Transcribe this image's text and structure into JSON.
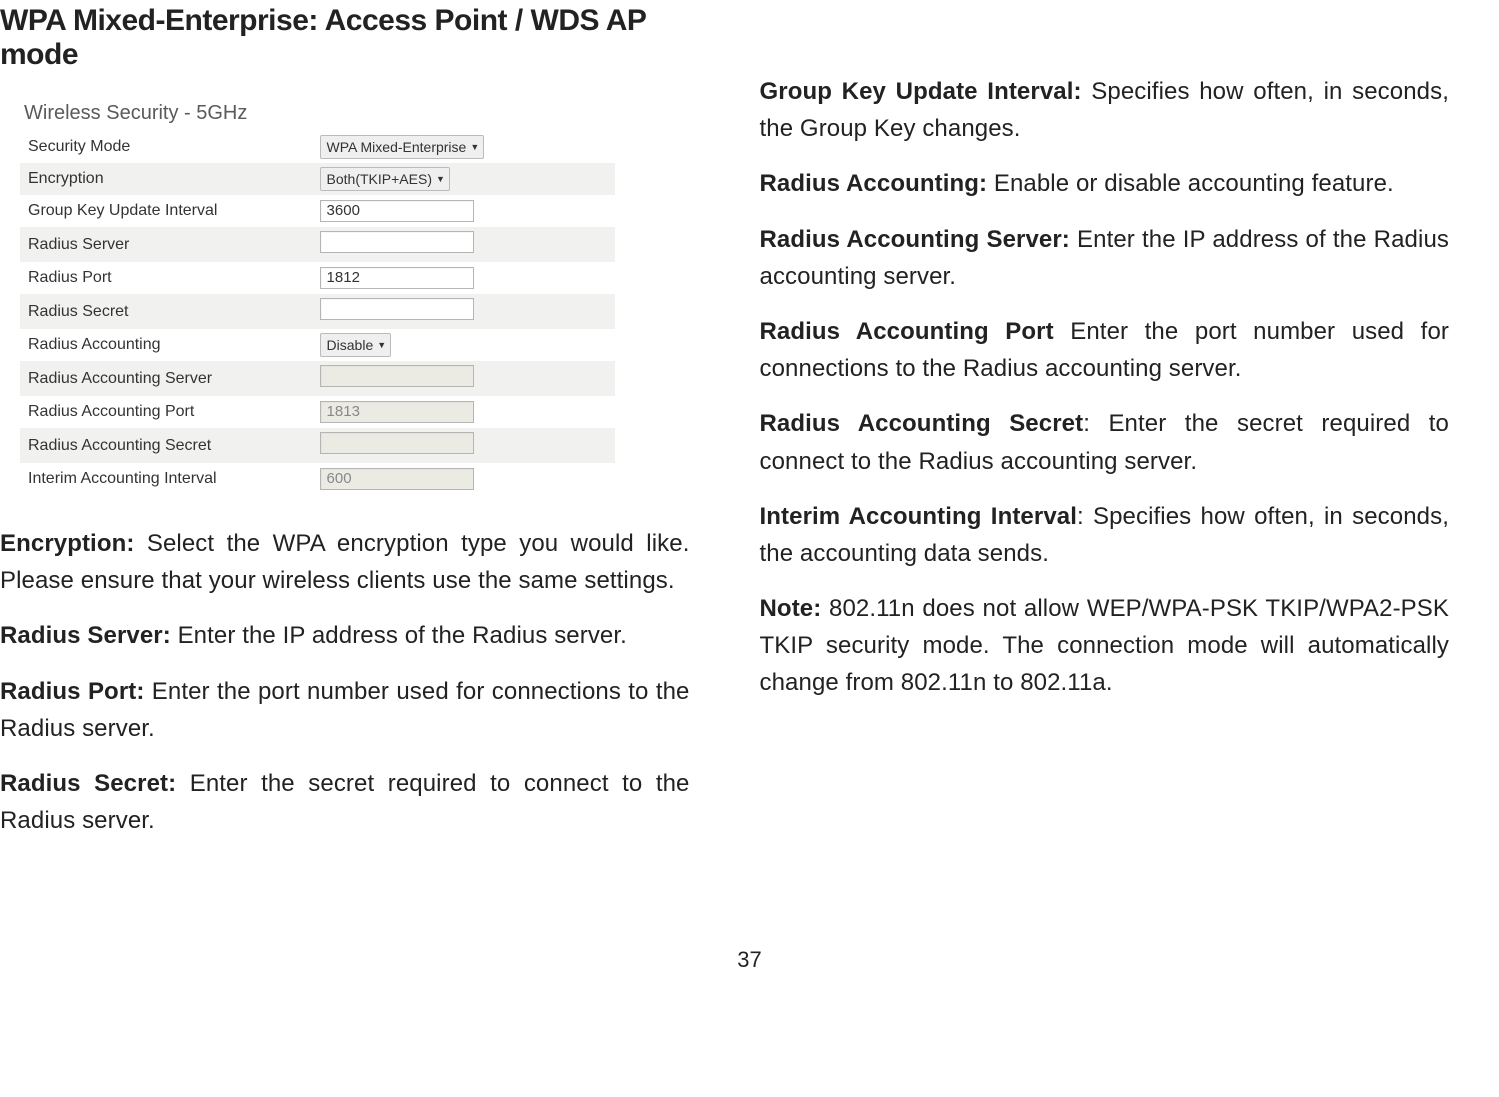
{
  "title": "WPA Mixed-Enterprise: Access Point / WDS AP mode",
  "figure": {
    "caption": "Wireless Security - 5GHz",
    "rows": [
      {
        "label": "Security Mode",
        "control": "select",
        "value": "WPA Mixed-Enterprise"
      },
      {
        "label": "Encryption",
        "control": "select",
        "value": "Both(TKIP+AES)"
      },
      {
        "label": "Group Key Update Interval",
        "control": "input",
        "value": "3600"
      },
      {
        "label": "Radius Server",
        "control": "input",
        "value": ""
      },
      {
        "label": "Radius Port",
        "control": "input",
        "value": "1812"
      },
      {
        "label": "Radius Secret",
        "control": "input",
        "value": ""
      },
      {
        "label": "Radius Accounting",
        "control": "select",
        "value": "Disable"
      },
      {
        "label": "Radius Accounting Server",
        "control": "input-disabled",
        "value": ""
      },
      {
        "label": "Radius Accounting Port",
        "control": "input-disabled",
        "value": "1813"
      },
      {
        "label": "Radius Accounting Secret",
        "control": "input-disabled",
        "value": ""
      },
      {
        "label": "Interim Accounting Interval",
        "control": "input-disabled",
        "value": "600"
      }
    ]
  },
  "left_paragraphs": {
    "encryption": {
      "term": "Encryption: ",
      "desc": "Select the WPA encryption type you would like. Please ensure that your wireless clients use the same settings."
    },
    "radius_server": {
      "term": "Radius Server: ",
      "desc": "Enter the IP address of the Radius server."
    },
    "radius_port": {
      "term": "Radius Port: ",
      "desc": "Enter the port number used for connections to the Radius server."
    },
    "radius_secret": {
      "term": "Radius Secret: ",
      "desc": "Enter the secret required to connect to the Radius server."
    }
  },
  "right_paragraphs": {
    "group_key": {
      "term": "Group Key Update Interval: ",
      "desc": "Specifies how often, in seconds, the Group Key changes."
    },
    "radius_accounting": {
      "term": "Radius Accounting: ",
      "desc": "Enable or disable accounting feature."
    },
    "radius_acc_server": {
      "term": "Radius Accounting Server: ",
      "desc": "Enter the IP address of the Radius accounting server."
    },
    "radius_acc_port": {
      "term": "Radius Accounting Port ",
      "desc": "Enter the port number used for connections to the Radius accounting server."
    },
    "radius_acc_secret": {
      "term": "Radius Accounting Secret",
      "desc": ": Enter the secret required to connect to the Radius accounting server."
    },
    "interim": {
      "term": "Interim Accounting Interval",
      "desc": ": Specifies how often, in seconds, the accounting data sends."
    },
    "note": {
      "term": "Note: ",
      "desc": "802.11n does not allow WEP/WPA-PSK TKIP/WPA2-PSK TKIP security mode. The connection mode will automatically change from 802.11n to 802.11a."
    }
  },
  "page_number": "37"
}
